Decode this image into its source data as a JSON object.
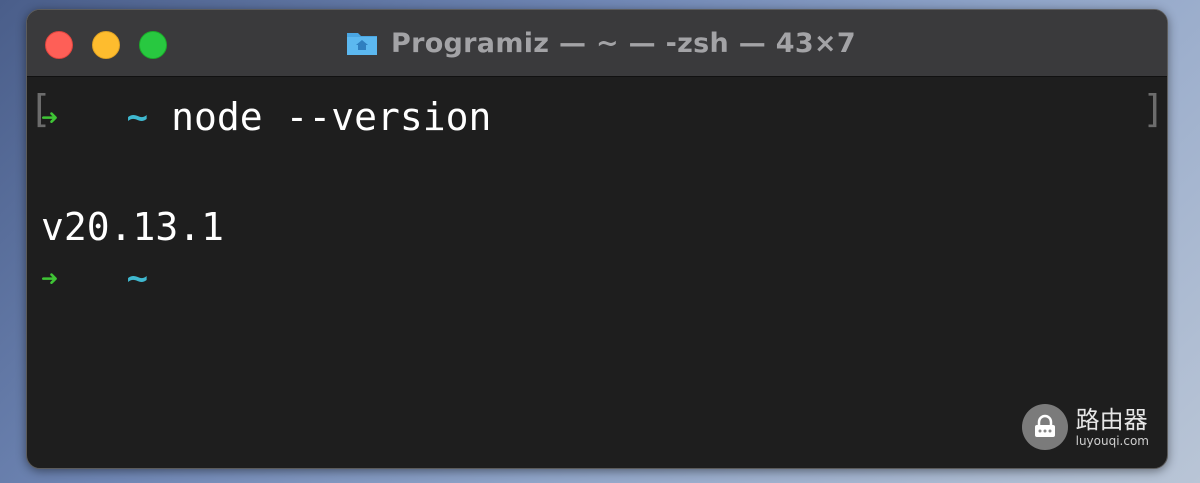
{
  "window": {
    "title": "Programiz — ~ — -zsh — 43×7",
    "folder_icon": "folder-home-icon"
  },
  "terminal": {
    "lines": [
      {
        "arrow": "➜",
        "tilde": "~",
        "command": "node --version"
      },
      {
        "output": "v20.13.1"
      },
      {
        "arrow": "➜",
        "tilde": "~",
        "command": ""
      }
    ],
    "bracket_left": "[",
    "bracket_right": "]"
  },
  "watermark": {
    "cn": "路由器",
    "en": "luyouqi.com",
    "logo_icon": "router-lock-icon"
  },
  "colors": {
    "prompt_arrow": "#3fc435",
    "prompt_tilde": "#3fb8cf",
    "background": "#1e1e1e",
    "titlebar": "#3a3a3c"
  }
}
